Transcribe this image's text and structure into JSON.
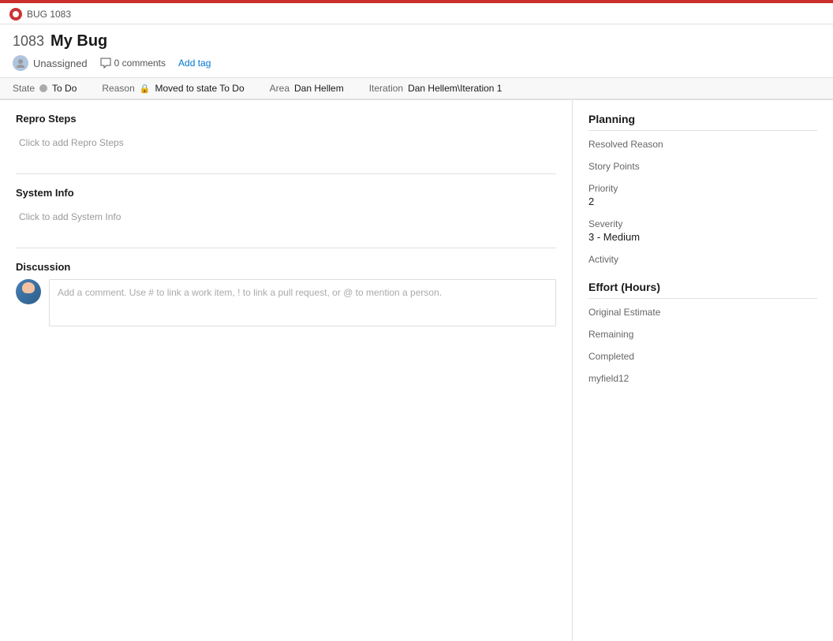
{
  "titlebar": {
    "bug_icon_label": "BUG",
    "tab_label": "BUG 1083"
  },
  "header": {
    "work_item_id": "1083",
    "work_item_title": "My Bug",
    "assignee_label": "Unassigned",
    "comments_count": "0 comments",
    "add_tag_label": "Add tag"
  },
  "fields": {
    "state_label": "State",
    "state_value": "To Do",
    "reason_label": "Reason",
    "reason_value": "Moved to state To Do",
    "area_label": "Area",
    "area_value": "Dan Hellem",
    "iteration_label": "Iteration",
    "iteration_value": "Dan Hellem\\Iteration 1"
  },
  "left": {
    "repro_steps_title": "Repro Steps",
    "repro_steps_placeholder": "Click to add Repro Steps",
    "system_info_title": "System Info",
    "system_info_placeholder": "Click to add System Info",
    "discussion_title": "Discussion",
    "comment_placeholder": "Add a comment. Use # to link a work item, ! to link a pull request, or @ to mention a person."
  },
  "right": {
    "planning_title": "Planning",
    "resolved_reason_label": "Resolved Reason",
    "resolved_reason_value": "",
    "story_points_label": "Story Points",
    "story_points_value": "",
    "priority_label": "Priority",
    "priority_value": "2",
    "severity_label": "Severity",
    "severity_value": "3 - Medium",
    "activity_label": "Activity",
    "activity_value": "",
    "effort_title": "Effort (Hours)",
    "original_estimate_label": "Original Estimate",
    "original_estimate_value": "",
    "remaining_label": "Remaining",
    "remaining_value": "",
    "completed_label": "Completed",
    "completed_value": "",
    "myfield_label": "myfield12",
    "myfield_value": ""
  }
}
